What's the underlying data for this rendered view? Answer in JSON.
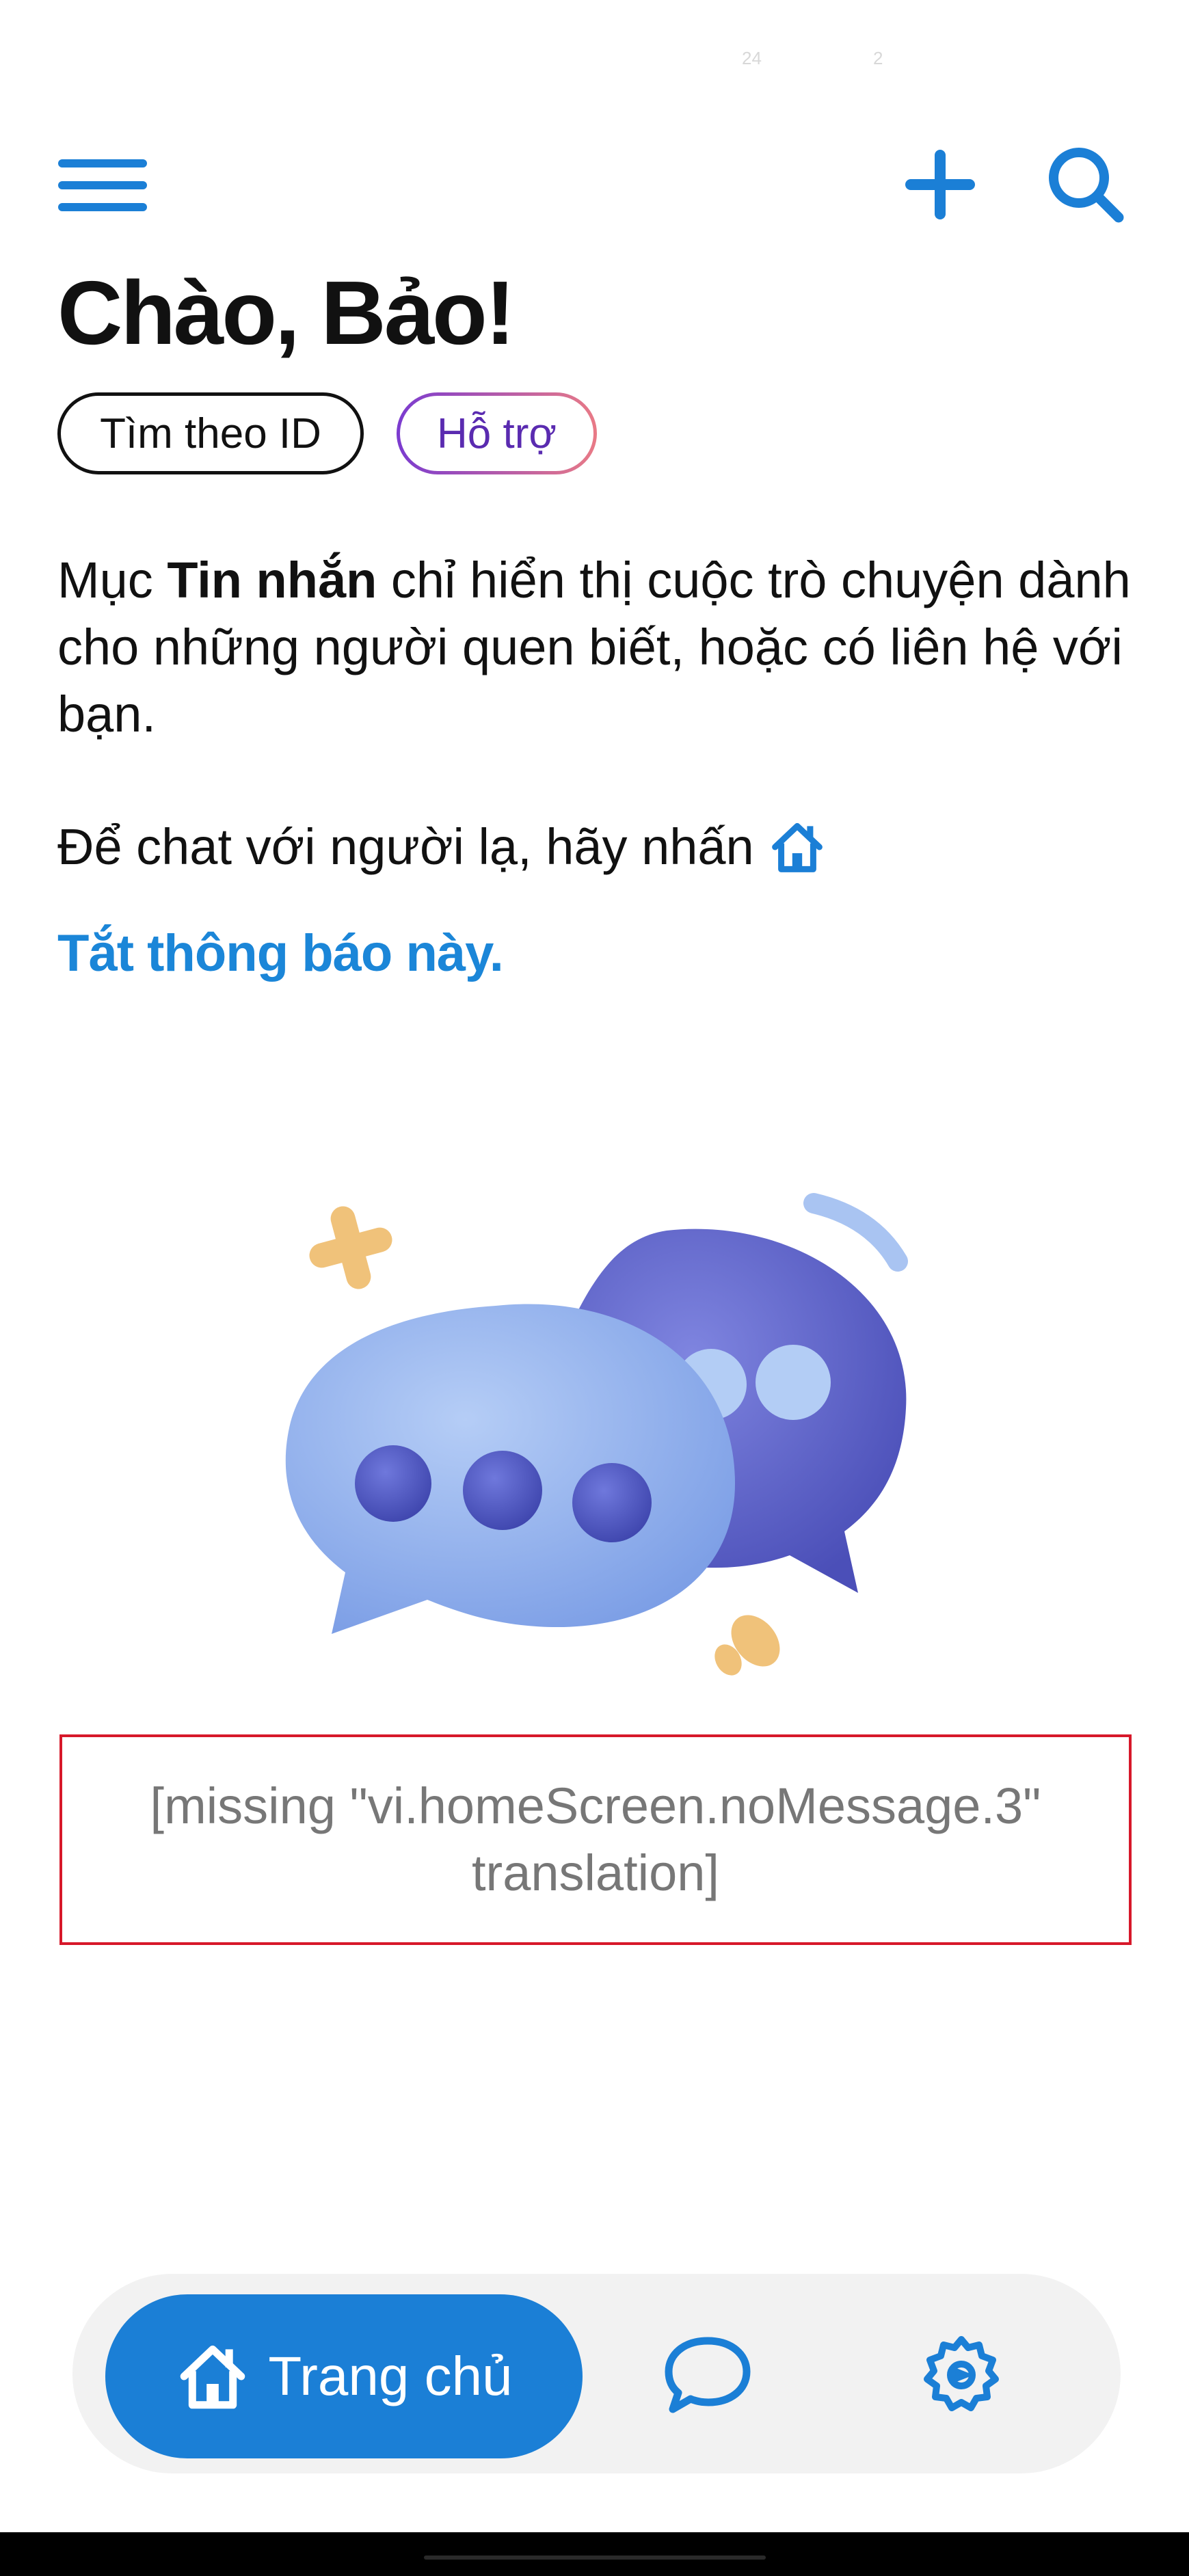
{
  "status_bar": {
    "item_left": "24",
    "item_right": "2"
  },
  "header": {
    "greeting": "Chào, Bảo!",
    "chips": {
      "find_by_id": "Tìm theo ID",
      "support": "Hỗ trợ"
    }
  },
  "notice": {
    "prefix": "Mục ",
    "bold": "Tin nhắn",
    "suffix": " chỉ hiển thị cuộc trò chuyện dành cho những người quen biết, hoặc có liên hệ với bạn.",
    "stranger_line": "Để chat với người lạ, hãy nhấn",
    "dismiss_link": "Tắt thông báo này."
  },
  "empty_state": {
    "missing_translation": "[missing \"vi.homeScreen.noMessage.3\" translation]"
  },
  "bottom_nav": {
    "home_label": "Trang chủ",
    "icons": [
      "home-icon",
      "chat-bubble-icon",
      "settings-icon"
    ]
  },
  "colors": {
    "accent_blue": "#1b7fd6",
    "link_blue": "#1b86d8",
    "support_text": "#5a2bb0",
    "error_border": "#d7182a",
    "bubble_front": "#8fb1ee",
    "bubble_back": "#5f62c8",
    "dots": "#4e55c0"
  }
}
